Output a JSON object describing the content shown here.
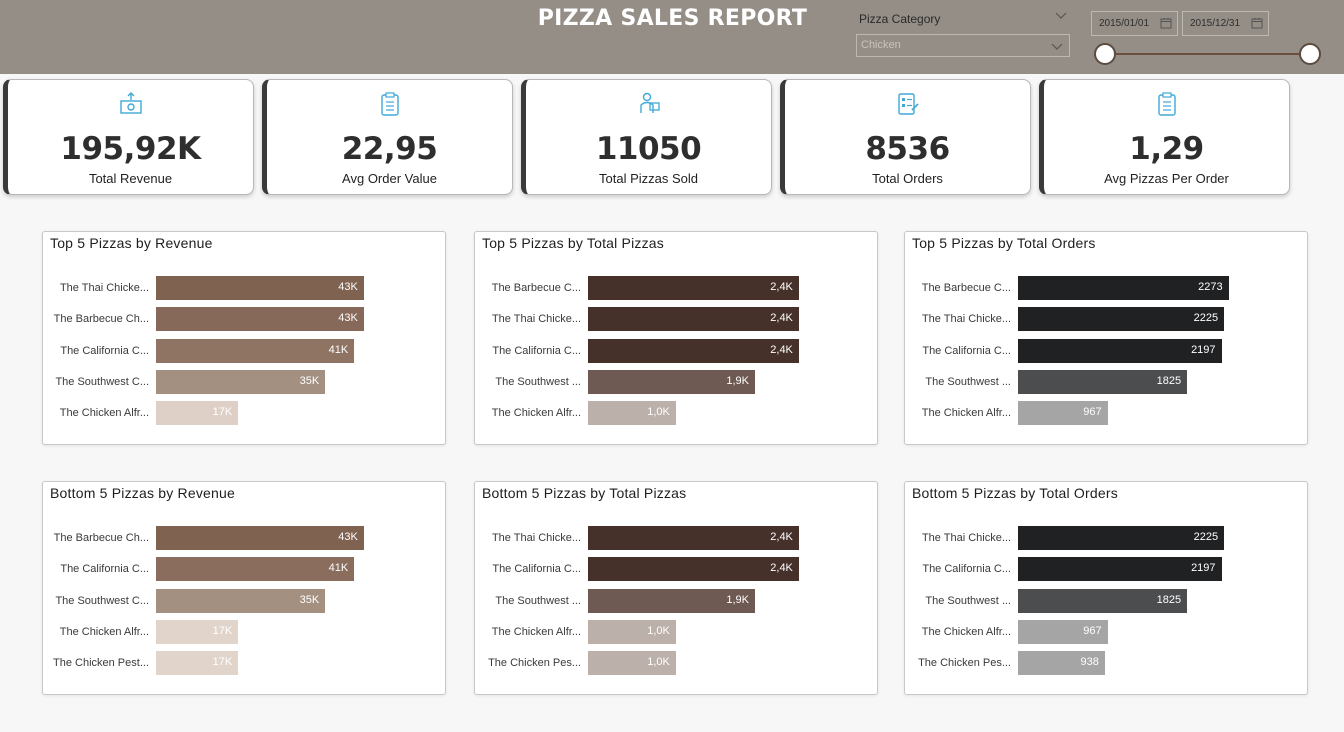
{
  "header": {
    "title": "PIZZA SALES REPORT",
    "category_slicer": {
      "label": "Pizza Category",
      "value": "Chicken"
    },
    "date_range": {
      "start": "2015/01/01",
      "end": "2015/12/31"
    }
  },
  "kpis": [
    {
      "value": "195,92K",
      "label": "Total Revenue",
      "icon": "money-icon"
    },
    {
      "value": "22,95",
      "label": "Avg Order Value",
      "icon": "clipboard-icon"
    },
    {
      "value": "11050",
      "label": "Total Pizzas Sold",
      "icon": "delivery-icon"
    },
    {
      "value": "8536",
      "label": "Total Orders",
      "icon": "order-list-icon"
    },
    {
      "value": "1,29",
      "label": "Avg Pizzas Per Order",
      "icon": "clipboard-icon"
    }
  ],
  "colors": {
    "header_bg": "#948e87",
    "revenue": [
      "#7f6250",
      "#87695a",
      "#9a8070",
      "#a39081",
      "#ded0c7"
    ],
    "pizzas": [
      "#463028",
      "#5f4a42",
      "#bcb0ab"
    ],
    "orders": [
      "#1f2123",
      "#4c4d4f",
      "#a5a5a5"
    ]
  },
  "charts": [
    {
      "title": "Top 5 Pizzas by Revenue",
      "chart_data": {
        "type": "bar",
        "categories": [
          "The Thai Chicke...",
          "The Barbecue Ch...",
          "The California C...",
          "The Southwest C...",
          "The Chicken Alfr..."
        ],
        "values": [
          43,
          43,
          41,
          35,
          17
        ],
        "labels": [
          "43K",
          "43K",
          "41K",
          "35K",
          "17K"
        ],
        "colors": [
          "#7f6250",
          "#87695a",
          "#8f7463",
          "#a39081",
          "#ded0c7"
        ],
        "xlim": [
          0,
          60
        ]
      }
    },
    {
      "title": "Top 5 Pizzas by Total Pizzas",
      "chart_data": {
        "type": "bar",
        "categories": [
          "The Barbecue C...",
          "The Thai Chicke...",
          "The California C...",
          "The Southwest ...",
          "The Chicken Alfr..."
        ],
        "values": [
          2.4,
          2.4,
          2.4,
          1.9,
          1.0
        ],
        "labels": [
          "2,4K",
          "2,4K",
          "2,4K",
          "1,9K",
          "1,0K"
        ],
        "colors": [
          "#45302a",
          "#45302a",
          "#45302a",
          "#6e5a52",
          "#bcb0ab"
        ],
        "xlim": [
          0,
          3.3
        ]
      }
    },
    {
      "title": "Top 5 Pizzas by Total Orders",
      "chart_data": {
        "type": "bar",
        "categories": [
          "The Barbecue C...",
          "The Thai Chicke...",
          "The California C...",
          "The Southwest ...",
          "The Chicken Alfr..."
        ],
        "values": [
          2273,
          2225,
          2197,
          1825,
          967
        ],
        "labels": [
          "2273",
          "2225",
          "2197",
          "1825",
          "967"
        ],
        "colors": [
          "#1f2123",
          "#1f2123",
          "#1f2123",
          "#4c4d4f",
          "#a5a5a5"
        ],
        "xlim": [
          0,
          3130
        ]
      }
    },
    {
      "title": "Bottom 5 Pizzas by Revenue",
      "chart_data": {
        "type": "bar",
        "categories": [
          "The Barbecue Ch...",
          "The California C...",
          "The Southwest C...",
          "The Chicken Alfr...",
          "The Chicken Pest..."
        ],
        "values": [
          43,
          41,
          35,
          17,
          17
        ],
        "labels": [
          "43K",
          "41K",
          "35K",
          "17K",
          "17K"
        ],
        "colors": [
          "#7f6250",
          "#8a6d5c",
          "#a39081",
          "#e1d4cb",
          "#e1d4cb"
        ],
        "xlim": [
          0,
          60
        ]
      }
    },
    {
      "title": "Bottom 5 Pizzas by Total Pizzas",
      "chart_data": {
        "type": "bar",
        "categories": [
          "The Thai Chicke...",
          "The California C...",
          "The Southwest ...",
          "The Chicken Alfr...",
          "The Chicken Pes..."
        ],
        "values": [
          2.4,
          2.4,
          1.9,
          1.0,
          1.0
        ],
        "labels": [
          "2,4K",
          "2,4K",
          "1,9K",
          "1,0K",
          "1,0K"
        ],
        "colors": [
          "#45302a",
          "#45302a",
          "#6e5a52",
          "#bcb0ab",
          "#bcb0ab"
        ],
        "xlim": [
          0,
          3.3
        ]
      }
    },
    {
      "title": "Bottom 5 Pizzas by Total Orders",
      "chart_data": {
        "type": "bar",
        "categories": [
          "The Thai Chicke...",
          "The California C...",
          "The Southwest ...",
          "The Chicken Alfr...",
          "The Chicken Pes..."
        ],
        "values": [
          2225,
          2197,
          1825,
          967,
          938
        ],
        "labels": [
          "2225",
          "2197",
          "1825",
          "967",
          "938"
        ],
        "colors": [
          "#1f2123",
          "#1f2123",
          "#4c4d4f",
          "#a5a5a5",
          "#a5a5a5"
        ],
        "xlim": [
          0,
          3130
        ]
      }
    }
  ]
}
